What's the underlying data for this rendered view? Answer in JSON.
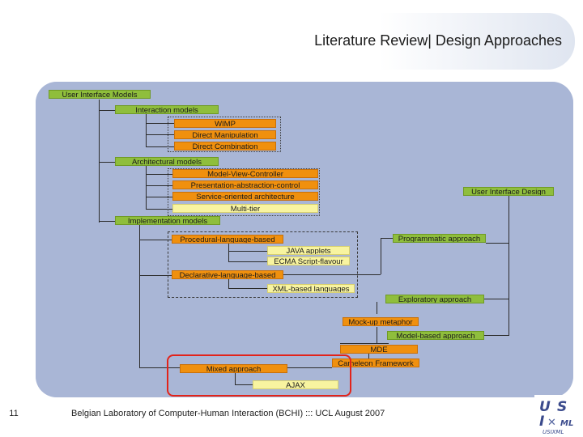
{
  "slide": {
    "title": "Literature Review| Design Approaches",
    "page_number": "11",
    "footer": "Belgian Laboratory of Computer-Human Interaction (BCHI) ::: UCL  August 2007"
  },
  "diagram": {
    "root": "User Interface Models",
    "interaction_models": "Interaction models",
    "wimp": "WIMP",
    "direct_manipulation": "Direct Manipulation",
    "direct_combination": "Direct Combination",
    "architectural_models": "Architectural models",
    "mvc": "Model-View-Controller",
    "pac": "Presentation-abstraction-control",
    "soa": "Service-oriented architecture",
    "multitier": "Multi-tier",
    "implementation_models": "Implementation models",
    "procedural": "Procedural-language-based",
    "java": "JAVA applets",
    "ecma": "ECMA Script-flavour",
    "declarative": "Declarative-language-based",
    "xml": "XML-based languages",
    "mixed": "Mixed approach",
    "ajax": "AJAX",
    "ui_design": "User Interface Design",
    "programmatic": "Programmatic approach",
    "exploratory": "Exploratory approach",
    "mockup": "Mock-up metaphor",
    "model_based": "Model-based approach",
    "mde": "MDE",
    "cameleon": "Cameleon Framework"
  },
  "logo": {
    "text_top": "U S",
    "text_bottom": "I XL",
    "caption": "USIXML"
  }
}
